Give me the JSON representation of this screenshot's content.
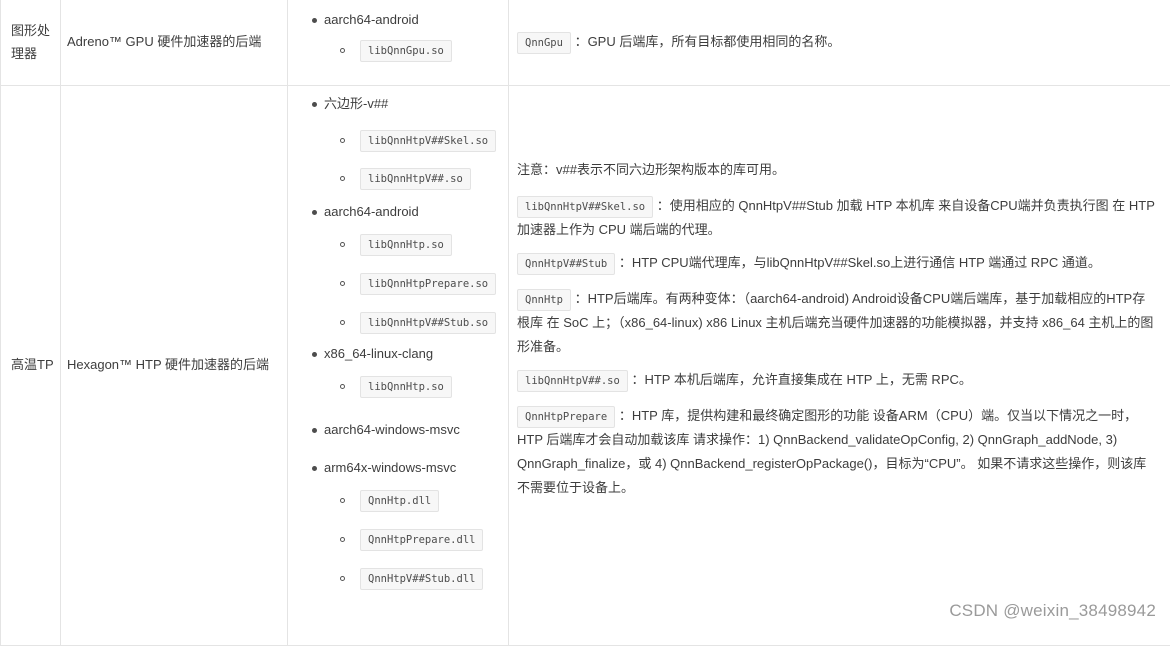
{
  "rows": [
    {
      "processor": "图形处理器",
      "description": "Adreno™ GPU 硬件加速器的后端",
      "targets": [
        {
          "name": "aarch64-android",
          "libs": [
            "libQnnGpu.so"
          ]
        }
      ],
      "notes": [
        {
          "code": "QnnGpu",
          "text": "：GPU 后端库，所有目标都使用相同的名称。"
        }
      ]
    },
    {
      "processor": "高温TP",
      "description": "Hexagon™ HTP 硬件加速器的后端",
      "targets": [
        {
          "name": "六边形-v##",
          "libs": [
            "libQnnHtpV##Skel.so",
            "libQnnHtpV##.so"
          ]
        },
        {
          "name": "aarch64-android",
          "libs": [
            "libQnnHtp.so",
            "libQnnHtpPrepare.so",
            "libQnnHtpV##Stub.so"
          ]
        },
        {
          "name": "x86_64-linux-clang",
          "libs": [
            "libQnnHtp.so"
          ]
        },
        {
          "name": "aarch64-windows-msvc",
          "libs": []
        },
        {
          "name": "arm64x-windows-msvc",
          "libs": [
            "QnnHtp.dll",
            "QnnHtpPrepare.dll",
            "QnnHtpV##Stub.dll"
          ]
        }
      ],
      "note_header": "注意：v##表示不同六边形架构版本的库可用。",
      "notes": [
        {
          "code": "libQnnHtpV##Skel.so",
          "text": "：使用相应的 QnnHtpV##Stub 加载 HTP 本机库 来自设备CPU端并负责执行图 在 HTP 加速器上作为 CPU 端后端的代理。"
        },
        {
          "code": "QnnHtpV##Stub",
          "text": "：HTP CPU端代理库，与libQnnHtpV##Skel.so上进行通信 HTP 端通过 RPC 通道。"
        },
        {
          "code": "QnnHtp",
          "text": "：HTP后端库。有两种变体：（aarch64-android) Android设备CPU端后端库，基于加载相应的HTP存根库 在 SoC 上；（x86_64-linux) x86 Linux 主机后端充当硬件加速器的功能模拟器，并支持 x86_64 主机上的图形准备。"
        },
        {
          "code": "libQnnHtpV##.so",
          "text": "：HTP 本机后端库，允许直接集成在 HTP 上，无需 RPC。"
        },
        {
          "code": "QnnHtpPrepare",
          "text": "：HTP 库，提供构建和最终确定图形的功能 设备ARM（CPU）端。仅当以下情况之一时，HTP 后端库才会自动加载该库 请求操作：1) QnnBackend_validateOpConfig, 2) QnnGraph_addNode, 3) QnnGraph_finalize，或 4) QnnBackend_registerOpPackage()，目标为“CPU”。 如果不请求这些操作，则该库不需要位于设备上。"
        }
      ]
    }
  ],
  "watermark": "CSDN @weixin_38498942"
}
